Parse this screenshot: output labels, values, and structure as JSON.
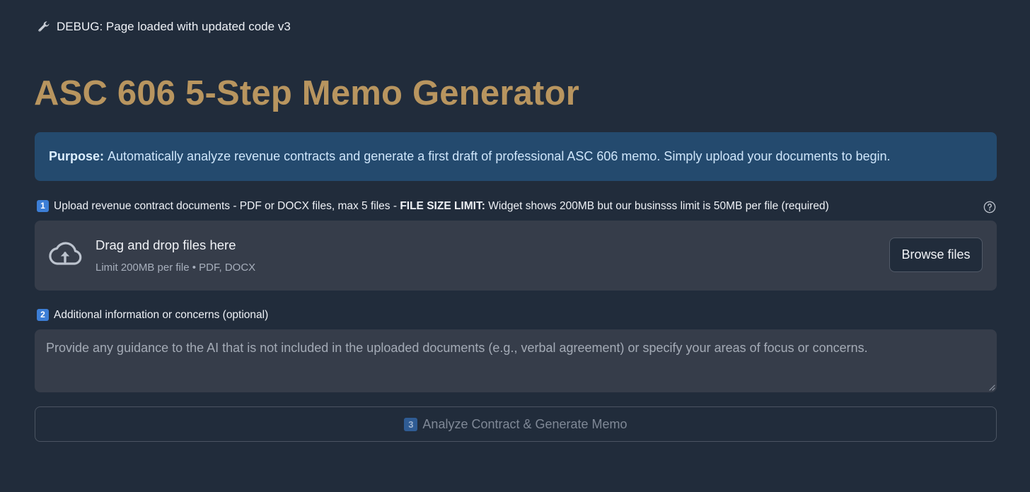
{
  "debug": {
    "icon": "wrench-icon",
    "text": "DEBUG: Page loaded with updated code v3"
  },
  "title": "ASC 606 5-Step Memo Generator",
  "purpose": {
    "label": "Purpose:",
    "text": "Automatically analyze revenue contracts and generate a first draft of professional ASC 606 memo. Simply upload your documents to begin."
  },
  "upload": {
    "step_number": "1",
    "label_prefix": "Upload revenue contract documents - PDF or DOCX files, max 5 files -",
    "label_bold": "FILE SIZE LIMIT:",
    "label_suffix": "Widget shows 200MB but our businsss limit is 50MB per file (required)",
    "help_icon": "question-circle-icon",
    "dropzone_title": "Drag and drop files here",
    "dropzone_subtitle": "Limit 200MB per file • PDF, DOCX",
    "browse_label": "Browse files"
  },
  "additional": {
    "step_number": "2",
    "label": "Additional information or concerns (optional)",
    "value": "",
    "placeholder": "Provide any guidance to the AI that is not included in the uploaded documents (e.g., verbal agreement) or specify your areas of focus or concerns."
  },
  "analyze": {
    "step_number": "3",
    "label": "Analyze Contract & Generate Memo"
  },
  "colors": {
    "background": "#212c3b",
    "title": "#b8955f",
    "purpose_bg": "#244a6e",
    "field_bg": "#363d4a"
  }
}
